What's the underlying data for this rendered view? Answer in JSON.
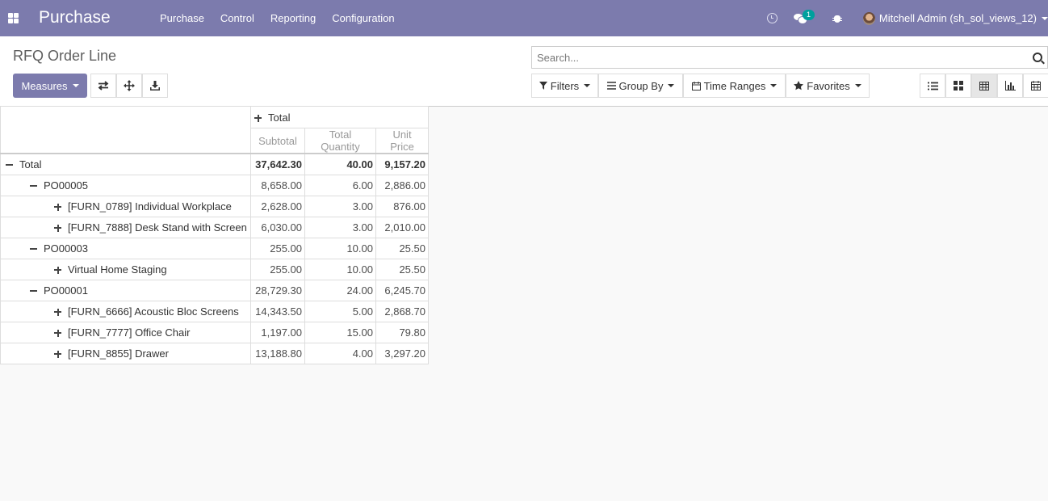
{
  "navbar": {
    "brand": "Purchase",
    "menu": [
      "Purchase",
      "Control",
      "Reporting",
      "Configuration"
    ],
    "messages_badge": "1",
    "user": "Mitchell Admin (sh_sol_views_12)"
  },
  "control": {
    "breadcrumb": "RFQ Order Line",
    "measures_label": "Measures",
    "search_placeholder": "Search...",
    "filters_label": "Filters",
    "groupby_label": "Group By",
    "timeranges_label": "Time Ranges",
    "favorites_label": "Favorites"
  },
  "pivot": {
    "col_group": "Total",
    "measures": [
      "Subtotal",
      "Total Quantity",
      "Unit Price"
    ],
    "rows": [
      {
        "label": "Total",
        "subtotal": "37,642.30",
        "qty": "40.00",
        "price": "9,157.20"
      },
      {
        "label": "PO00005",
        "subtotal": "8,658.00",
        "qty": "6.00",
        "price": "2,886.00"
      },
      {
        "label": "[FURN_0789] Individual Workplace",
        "subtotal": "2,628.00",
        "qty": "3.00",
        "price": "876.00"
      },
      {
        "label": "[FURN_7888] Desk Stand with Screen",
        "subtotal": "6,030.00",
        "qty": "3.00",
        "price": "2,010.00"
      },
      {
        "label": "PO00003",
        "subtotal": "255.00",
        "qty": "10.00",
        "price": "25.50"
      },
      {
        "label": "Virtual Home Staging",
        "subtotal": "255.00",
        "qty": "10.00",
        "price": "25.50"
      },
      {
        "label": "PO00001",
        "subtotal": "28,729.30",
        "qty": "24.00",
        "price": "6,245.70"
      },
      {
        "label": "[FURN_6666] Acoustic Bloc Screens",
        "subtotal": "14,343.50",
        "qty": "5.00",
        "price": "2,868.70"
      },
      {
        "label": "[FURN_7777] Office Chair",
        "subtotal": "1,197.00",
        "qty": "15.00",
        "price": "79.80"
      },
      {
        "label": "[FURN_8855] Drawer",
        "subtotal": "13,188.80",
        "qty": "4.00",
        "price": "3,297.20"
      }
    ]
  }
}
